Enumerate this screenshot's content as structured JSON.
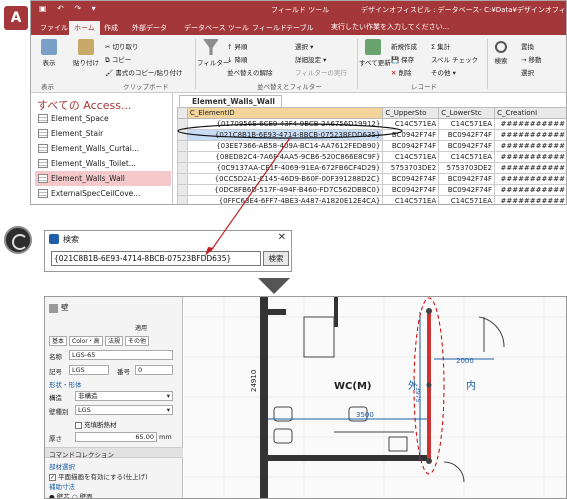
{
  "access": {
    "logo": "A",
    "title": "デザインオフィスビル : データベース- C:¥Data¥デザインオフィスビル.mdb",
    "context_tab": "フィールド ツール",
    "tabs": [
      "ファイル",
      "ホーム",
      "作成",
      "外部データ",
      "データベース ツール",
      "フィールド",
      "テーブル"
    ],
    "tell_me": "実行したい作業を入力してください...",
    "ribbon": {
      "view": "表示",
      "paste": "貼り付け",
      "cut": "切り取り",
      "copy": "コピー",
      "format_painter": "書式のコピー/貼り付け",
      "filter": "フィルター",
      "asc": "昇順",
      "desc": "降順",
      "clear_sort": "並べ替えの解除",
      "selection": "選択",
      "advanced": "詳細設定",
      "toggle_filter": "フィルターの実行",
      "refresh_all": "すべて更新",
      "new": "新規作成",
      "save": "保存",
      "delete": "削除",
      "totals": "集計",
      "spelling": "スペル チェック",
      "more": "その他",
      "find": "検索",
      "replace": "置換",
      "goto": "移動",
      "select": "選択",
      "group_views": "表示",
      "group_clipboard": "クリップボード",
      "group_sort_filter": "並べ替えとフィルター",
      "group_records": "レコード"
    },
    "nav": {
      "header": "すべての Access...",
      "items": [
        "Element_Space",
        "Element_Stair",
        "Element_Walls_Curtai...",
        "Element_Walls_Toilet...",
        "Element_Walls_Wall",
        "ExternalSpecCeilCove..."
      ],
      "selected_index": 4
    },
    "table": {
      "tab_label": "Element_Walls_Wall",
      "columns": [
        "C_ElementID",
        "C_UpperSto",
        "C_LowerStc",
        "C_CreationI"
      ],
      "rows": [
        [
          "{0170956E-6CE9-43F4-9BCB-2A6756D19912}",
          "C14C571EA",
          "C14C571EA",
          "###########"
        ],
        [
          "{021C8B1B-6E93-4714-8BCB-07523BFDD635}",
          "BC0942F74F",
          "BC0942F74F",
          "###########"
        ],
        [
          "{03EE7366-AB58-409A-BC14-AA7612FEDB90}",
          "BC0942F74F",
          "BC0942F74F",
          "###########"
        ],
        [
          "{08ED82C4-7A6F-4AA5-9CB6-520C866E8C9F}",
          "C14C571EA",
          "C14C571EA",
          "###########"
        ],
        [
          "{0C9137AA-CE1F-4069-91EA-672FB6CF4D29}",
          "5753703DE2",
          "5753703DE2",
          "###########"
        ],
        [
          "{0CC5D2A1-C145-46D9-B60F-00F391288D2C}",
          "BC0942F74F",
          "BC0942F74F",
          "###########"
        ],
        [
          "{0DC8FB6D-517F-494F-B460-FD7C562DBBC0}",
          "BC0942F74F",
          "BC0942F74F",
          "###########"
        ],
        [
          "{0FFC63E4-6FF7-4BE3-A487-A1820E12E4CA}",
          "C14C571EA",
          "C14C571EA",
          "###########"
        ]
      ],
      "selected_row": 1
    }
  },
  "search_dialog": {
    "title": "検索",
    "value": "{021C8B1B-6E93-4714-8BCB-07523BFDD635}",
    "button": "検索"
  },
  "cad": {
    "prop": {
      "title": "壁",
      "apply": "適用",
      "tabs": [
        "基本",
        "Color・高",
        "法規",
        "その他"
      ],
      "name_label": "名称",
      "name_value": "LGS-65",
      "code_label": "記号",
      "code_value": "LGS",
      "number_label": "番号",
      "number_value": "0",
      "section_shape": "形状・形体",
      "structure_label": "構造",
      "structure_value": "非構造",
      "material_label": "壁種別",
      "material_value": "LGS",
      "filler_label": "充填断熱材",
      "thickness_label": "厚さ",
      "thickness_value": "65.00",
      "thickness_unit": "mm",
      "section_command": "コマンドコレクション",
      "section_partial": "部材選択",
      "flat_check": "平面描画を有効にする(仕上げ)",
      "section_assist": "補助寸法",
      "radio_a": "壁芯",
      "radio_b": "壁面"
    },
    "plan": {
      "room_label": "WC(M)",
      "dim_2000": "2000",
      "dim_3500": "3500",
      "dim_24910": "24910",
      "dim_3975": "3975",
      "vertical_a": "外",
      "vertical_b": "内"
    }
  }
}
